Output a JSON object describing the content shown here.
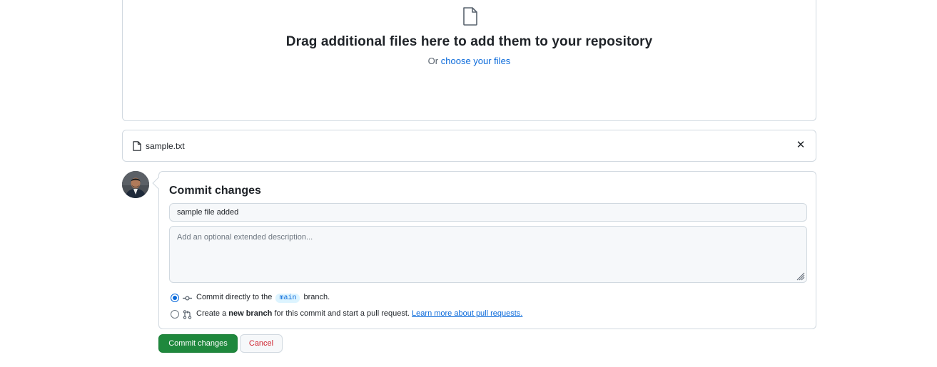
{
  "dropzone": {
    "icon": "file-icon",
    "title": "Drag additional files here to add them to your repository",
    "or_text": "Or",
    "choose_link": "choose your files"
  },
  "file_list": {
    "items": [
      {
        "icon": "file-icon",
        "name": "sample.txt",
        "remove": "✕"
      }
    ]
  },
  "commit": {
    "avatar": "user-avatar",
    "title": "Commit changes",
    "summary_value": "sample file added",
    "description_placeholder": "Add an optional extended description...",
    "options": [
      {
        "selected": true,
        "icon": "git-commit-icon",
        "text_before": "Commit directly to the",
        "branch": "main",
        "text_after": "branch."
      },
      {
        "selected": false,
        "icon": "git-pull-request-icon",
        "text_before": "Create a",
        "bold": "new branch",
        "text_after": "for this commit and start a pull request.",
        "link": "Learn more about pull requests."
      }
    ]
  },
  "actions": {
    "commit_label": "Commit changes",
    "cancel_label": "Cancel"
  },
  "colors": {
    "accent": "#0969da",
    "primary_button": "#1f883d",
    "danger_text": "#cf222e",
    "border": "#d1d9e0"
  }
}
